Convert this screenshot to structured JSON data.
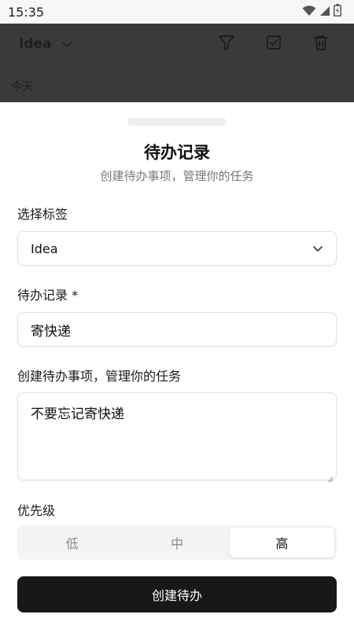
{
  "status_bar": {
    "time": "15:35",
    "icons": [
      "wifi-icon",
      "cellular-signal-icon",
      "battery-icon"
    ]
  },
  "header": {
    "tag_selected": "Idea",
    "actions": [
      "filter-icon",
      "checkbox-icon",
      "trash-icon"
    ],
    "date_group": "今天"
  },
  "sheet": {
    "title": "待办记录",
    "subtitle": "创建待办事项，管理你的任务",
    "tag_field": {
      "label": "选择标签",
      "value": "Idea"
    },
    "todo_field": {
      "label": "待办记录 *",
      "value": "寄快递"
    },
    "description_field": {
      "label": "创建待办事项，管理你的任务",
      "value": "不要忘记寄快递"
    },
    "priority": {
      "label": "优先级",
      "options": [
        "低",
        "中",
        "高"
      ],
      "selected": "高"
    },
    "submit_label": "创建待办"
  },
  "colors": {
    "overlay": "#3a3a3a",
    "primary_button": "#18181b",
    "segment_bg": "#f4f4f5"
  }
}
